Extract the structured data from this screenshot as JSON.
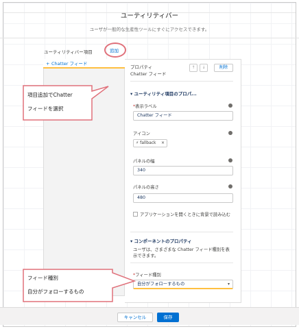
{
  "modal": {
    "title": "ユーティリティバー",
    "subtitle": "ユーザが一般的な生産性ツールにすぐにアクセスできます。"
  },
  "items_section": {
    "label": "ユーティリティバー項目",
    "add_link": "追加"
  },
  "left_list": {
    "items": [
      {
        "label": "Chatter フィード",
        "plus": "+"
      }
    ]
  },
  "properties": {
    "header_line1": "プロパティ",
    "header_line2": "Chatter フィード",
    "up_icon": "↑",
    "down_icon": "↓",
    "delete_label": "削除",
    "utility_section_title": "ユーティリティ項目のプロパ...",
    "label_field_label": "表示ラベル",
    "label_field_value": "Chatter フィード",
    "icon_field_label": "アイコン",
    "icon_pill_value": "fallback",
    "icon_pill_close": "×",
    "panel_width_label": "パネルの幅",
    "panel_width_value": "340",
    "panel_height_label": "パネルの高さ",
    "panel_height_value": "480",
    "load_checkbox_label": "アプリケーションを開くときに背景で読み込む",
    "component_section_title": "コンポーネントのプロパティ",
    "component_desc": "ユーザは、さまざまな Chatter フィード種別を表示できます。",
    "feed_type_label": "フィード種別",
    "feed_type_value": "自分がフォローするもの",
    "required_mark": "*"
  },
  "callouts": {
    "top_line1": "項目追加でChatter",
    "top_line2": "フィードを選択",
    "bottom_line1": "フィード種別",
    "bottom_line2": "自分がフォローするもの"
  },
  "footer": {
    "cancel_label": "キャンセル",
    "save_label": "保存"
  },
  "colors": {
    "accent": "#0070d2",
    "callout_border": "#e0707a",
    "selection_underline": "#ffbf3f"
  }
}
